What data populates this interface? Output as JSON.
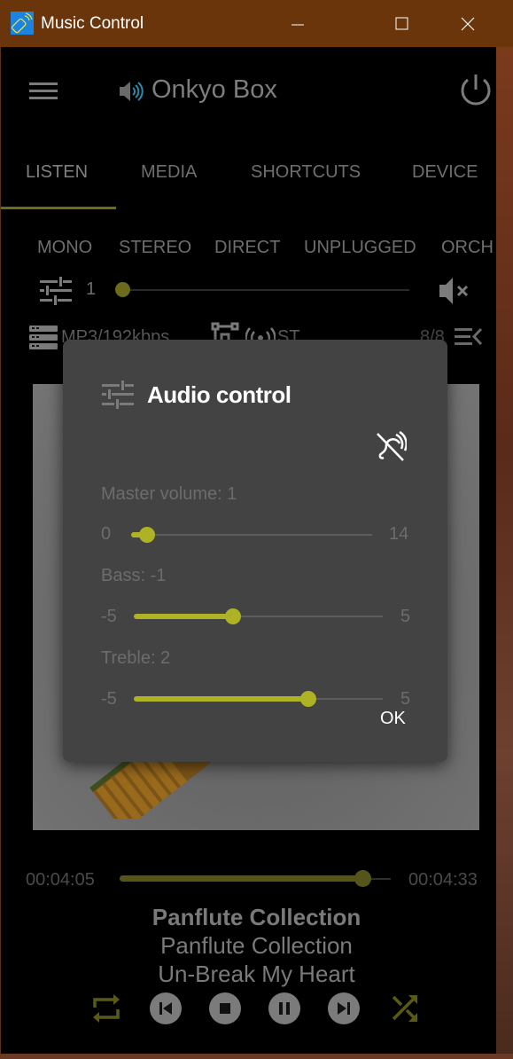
{
  "window": {
    "title": "Music Control",
    "minimize_label": "Minimize",
    "maximize_label": "Maximize",
    "close_label": "Close"
  },
  "header": {
    "device_name": "Onkyo Box"
  },
  "tabs": [
    {
      "label": "LISTEN",
      "active": true
    },
    {
      "label": "MEDIA",
      "active": false
    },
    {
      "label": "SHORTCUTS",
      "active": false
    },
    {
      "label": "DEVICE",
      "active": false
    }
  ],
  "listening_modes": [
    "MONO",
    "STEREO",
    "DIRECT",
    "UNPLUGGED",
    "ORCH"
  ],
  "volume": {
    "value": "1",
    "min": 0,
    "max": 14,
    "level": 1
  },
  "info": {
    "format": "MP3/192kbps",
    "channel": "ST",
    "track_count": "8/8"
  },
  "playback": {
    "elapsed": "00:04:05",
    "total": "00:04:33",
    "progress_fraction": 0.897
  },
  "now_playing": {
    "album": "Panflute Collection",
    "artist": "Panflute Collection",
    "title": "Un-Break My Heart"
  },
  "controls": [
    "repeat",
    "previous",
    "stop",
    "pause",
    "next",
    "shuffle"
  ],
  "dialog": {
    "title": "Audio control",
    "master_volume": {
      "label": "Master volume: 1",
      "min_label": "0",
      "max_label": "14",
      "min": 0,
      "max": 14,
      "value": 1
    },
    "bass": {
      "label": "Bass: -1",
      "min_label": "-5",
      "max_label": "5",
      "min": -5,
      "max": 5,
      "value": -1
    },
    "treble": {
      "label": "Treble: 2",
      "min_label": "-5",
      "max_label": "5",
      "min": -5,
      "max": 5,
      "value": 2
    },
    "ok_label": "OK"
  },
  "colors": {
    "titlebar": "#6b350b",
    "accent": "#aeb225",
    "accent_dimmed": "#6b6b1a",
    "dialog_bg": "#434343"
  }
}
